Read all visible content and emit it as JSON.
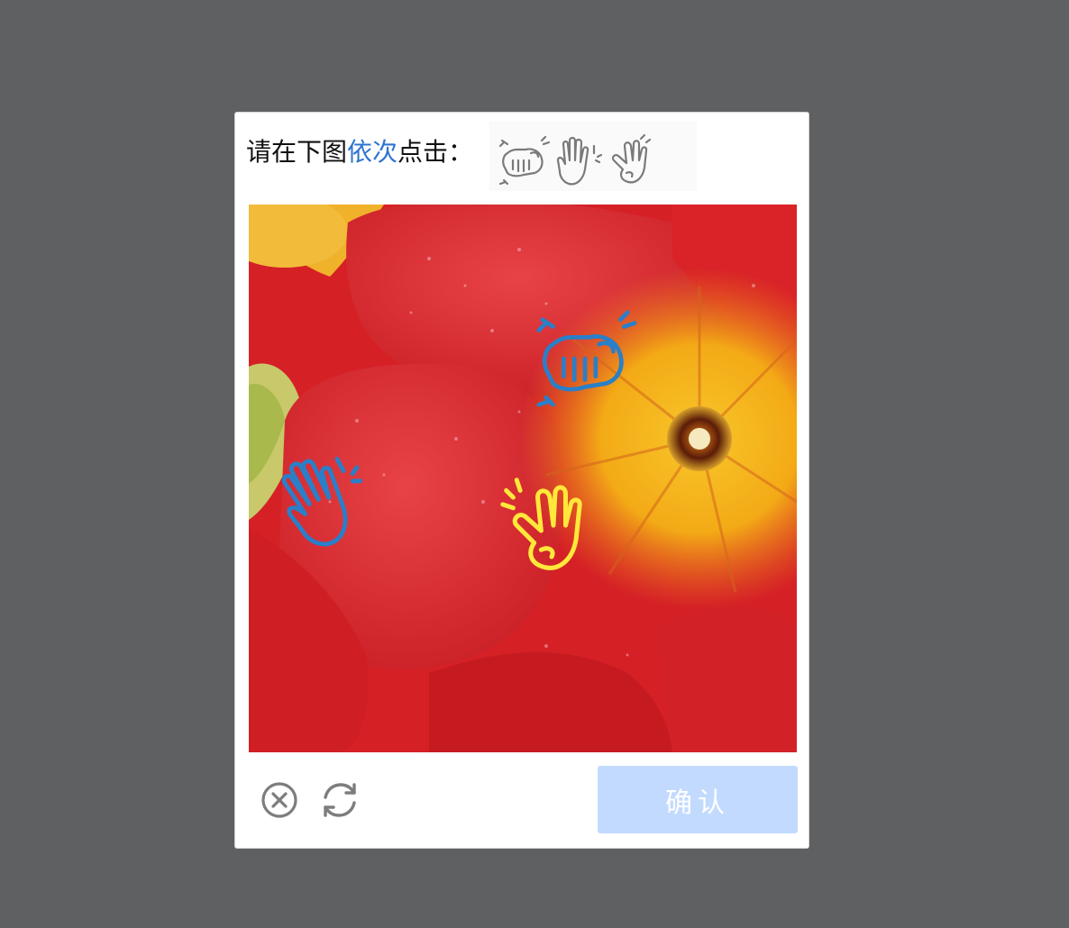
{
  "prompt": {
    "prefix": "请在下图",
    "highlight": "依次",
    "suffix": "点击："
  },
  "hint_icons": [
    "fist-bump-icon",
    "raised-hand-icon",
    "ok-hand-icon"
  ],
  "targets": [
    {
      "icon": "fist-bump-icon",
      "color": "#2a7fc8"
    },
    {
      "icon": "raised-hand-icon",
      "color": "#2a7fc8"
    },
    {
      "icon": "ok-hand-icon",
      "color": "#ffe83a"
    }
  ],
  "footer": {
    "close_icon": "close-circle-icon",
    "refresh_icon": "refresh-icon",
    "confirm_label": "确认"
  },
  "colors": {
    "overlay": "#5f6062",
    "highlight": "#2f74d0",
    "confirm_bg": "#c3daff",
    "petal_red": "#e0262a",
    "flower_yellow": "#f5b918"
  }
}
